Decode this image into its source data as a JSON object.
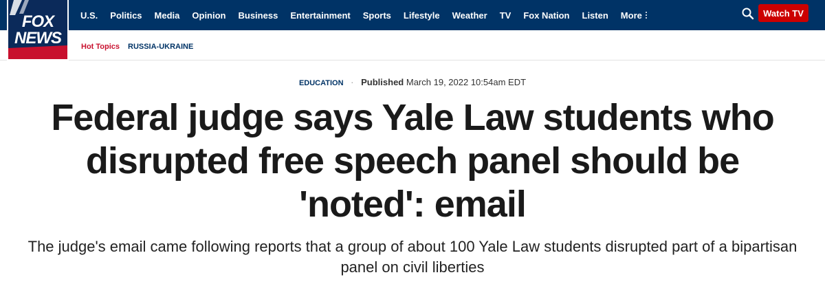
{
  "brand": {
    "logo_line1": "FOX",
    "logo_line2": "NEWS",
    "navy": "#003366",
    "red": "#cc0000"
  },
  "nav": {
    "items": [
      "U.S.",
      "Politics",
      "Media",
      "Opinion",
      "Business",
      "Entertainment",
      "Sports",
      "Lifestyle",
      "Weather",
      "TV",
      "Fox Nation",
      "Listen"
    ],
    "more_label": "More",
    "search_icon": "search-icon",
    "watch_tv_label": "Watch TV"
  },
  "hot_topics": {
    "label": "Hot Topics",
    "links": [
      "RUSSIA-UKRAINE"
    ]
  },
  "article": {
    "category": "EDUCATION",
    "published_label": "Published",
    "published_date": "March 19, 2022 10:54am EDT",
    "headline": "Federal judge says Yale Law students who disrupted free speech panel should be 'noted': email",
    "subheadline": "The judge's email came following reports that a group of about 100 Yale Law students disrupted part of a bipartisan panel on civil liberties"
  }
}
